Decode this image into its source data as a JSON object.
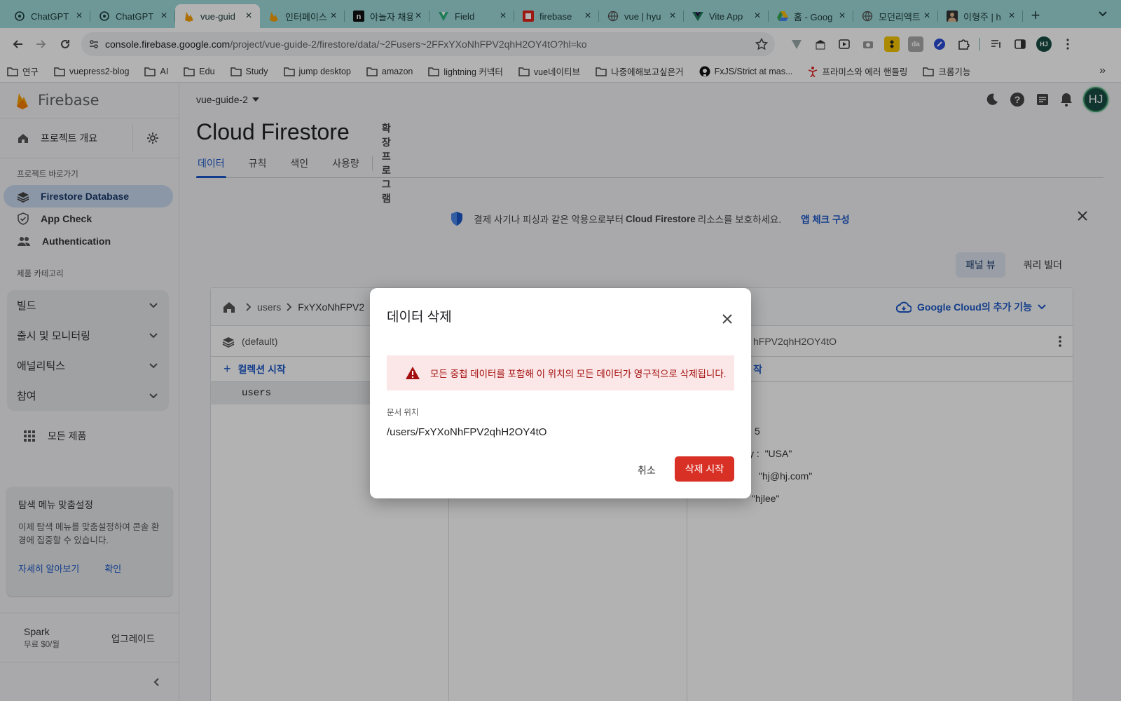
{
  "browser": {
    "tabs": [
      {
        "title": "ChatGPT",
        "icon": "chatgpt-icon"
      },
      {
        "title": "ChatGPT",
        "icon": "chatgpt-icon"
      },
      {
        "title": "vue-guid",
        "icon": "firebase-icon",
        "active": true
      },
      {
        "title": "인터페이스",
        "icon": "firebase-icon"
      },
      {
        "title": "야놀자 채용",
        "icon": "yanolja-icon"
      },
      {
        "title": "Field",
        "icon": "vuetify-icon"
      },
      {
        "title": "firebase",
        "icon": "fastcampus-icon"
      },
      {
        "title": "vue | hyu",
        "icon": "globe-icon"
      },
      {
        "title": "Vite App",
        "icon": "vue-icon"
      },
      {
        "title": "홈 - Goog",
        "icon": "google-drive-icon"
      },
      {
        "title": "모던리액트",
        "icon": "globe-icon"
      },
      {
        "title": "이형주 | h",
        "icon": "profile-icon"
      }
    ],
    "url_host": "console.firebase.google.com",
    "url_path": "/project/vue-guide-2/firestore/data/~2Fusers~2FFxYXoNhFPV2qhH2OY4tO?hl=ko",
    "profile_initials": "HJ",
    "bookmarks": [
      "연구",
      "vuepress2-blog",
      "AI",
      "Edu",
      "Study",
      "jump desktop",
      "amazon",
      "lightning 커넥터",
      "vue네이티브",
      "나중에해보고싶은거",
      "FxJS/Strict at mas...",
      "프라미스와 에러 핸들링",
      "크롬기능"
    ]
  },
  "sidebar": {
    "brand": "Firebase",
    "overview": "프로젝트 개요",
    "shortcuts_title": "프로젝트 바로가기",
    "shortcuts": [
      {
        "label": "Firestore Database",
        "icon": "firestore-icon"
      },
      {
        "label": "App Check",
        "icon": "shield-check-icon"
      },
      {
        "label": "Authentication",
        "icon": "people-icon"
      }
    ],
    "category_title": "제품 카테고리",
    "categories": [
      "빌드",
      "출시 및 모니터링",
      "애널리틱스",
      "참여"
    ],
    "all_products": "모든 제품",
    "card": {
      "title": "탐색 메뉴 맞춤설정",
      "body": "이제 탐색 메뉴를 맞춤설정하여 콘솔 환경에 집중할 수 있습니다.",
      "learn_more": "자세히 알아보기",
      "confirm": "확인"
    },
    "plan": {
      "name": "Spark",
      "price": "무료 $0/월",
      "upgrade": "업그레이드"
    }
  },
  "main": {
    "project": "vue-guide-2",
    "title": "Cloud Firestore",
    "tabs": [
      "데이터",
      "규칙",
      "색인",
      "사용량"
    ],
    "extensions_tab": "확장 프로그램",
    "banner": {
      "text_before": "결제 사기나 피싱과 같은 악용으로부터",
      "text_bold": "Cloud Firestore",
      "text_after": "리소스를 보호하세요.",
      "link": "앱 체크 구성"
    },
    "views": [
      "패널 뷰",
      "쿼리 빌더"
    ],
    "breadcrumb": [
      "users",
      "FxYXoNhFPV2"
    ],
    "gcloud_link": "Google Cloud의 추가 기능",
    "db_name": "(default)",
    "start_collection": "컬렉션 시작",
    "collections": [
      "users"
    ],
    "doc_id_partial": "hFPV2qhH2OY4tO",
    "start_field_partial": "작",
    "field_number_partial": "5",
    "fields": [
      {
        "key_partial": "y :",
        "value": "\"USA\""
      },
      {
        "key_partial": "",
        "value": "\"hj@hj.com\""
      },
      {
        "key_partial": "",
        "value": "\"hjlee\""
      }
    ]
  },
  "dialog": {
    "title": "데이터 삭제",
    "warning": "모든 중첩 데이터를 포함해 이 위치의 모든 데이터가 영구적으로 삭제됩니다.",
    "location_label": "문서 위치",
    "location_path": "/users/FxYXoNhFPV2qhH2OY4tO",
    "cancel": "취소",
    "delete": "삭제 시작"
  },
  "colors": {
    "tabbar": "#9ed8d8",
    "accent": "#1a56c8",
    "danger": "#d93025",
    "warning_bg": "#fbe7e7"
  }
}
